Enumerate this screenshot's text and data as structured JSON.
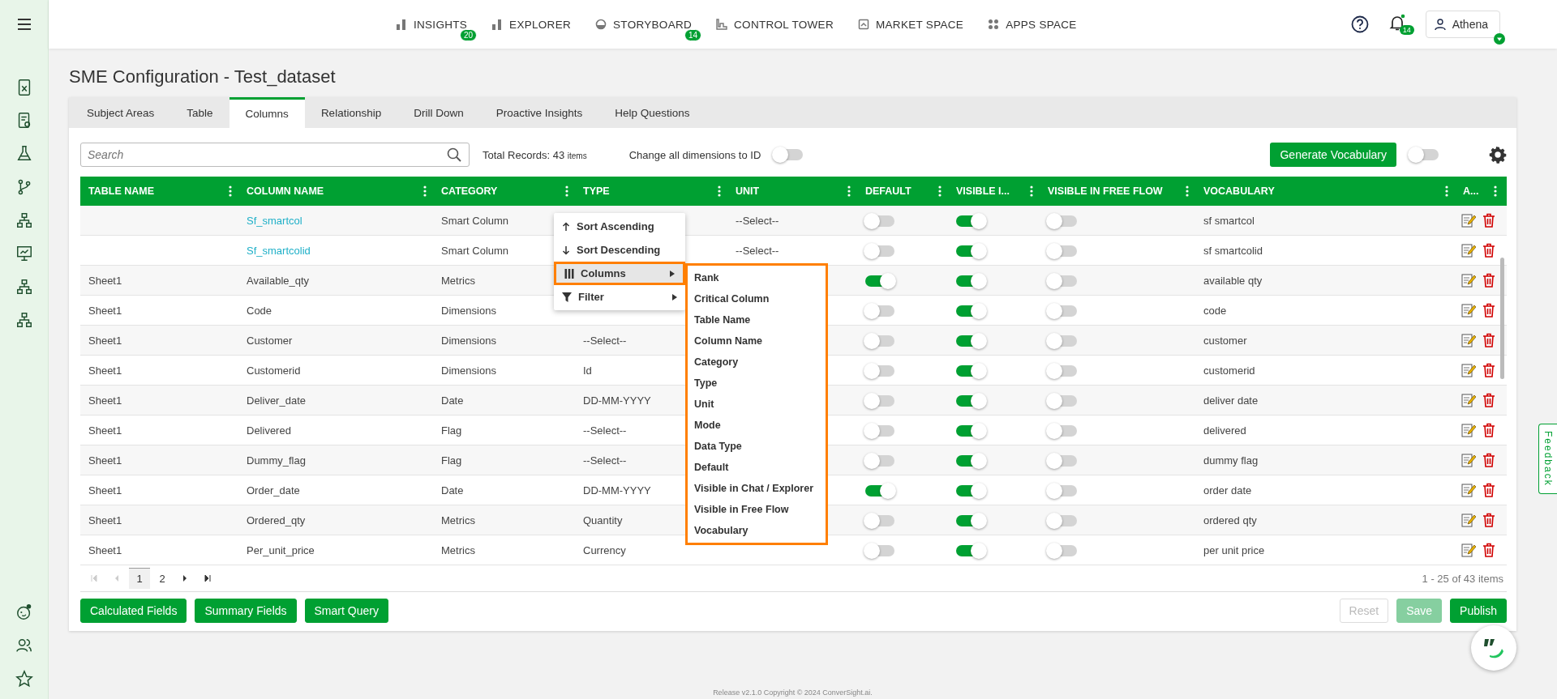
{
  "nav": [
    {
      "label": "INSIGHTS",
      "badge": "20"
    },
    {
      "label": "EXPLORER"
    },
    {
      "label": "STORYBOARD",
      "badge": "14"
    },
    {
      "label": "CONTROL TOWER"
    },
    {
      "label": "MARKET SPACE"
    },
    {
      "label": "APPS SPACE"
    }
  ],
  "notifications": {
    "badge": "14"
  },
  "user": {
    "name": "Athena"
  },
  "page_title": "SME Configuration - Test_dataset",
  "tabs": [
    {
      "label": "Subject Areas",
      "selected": false
    },
    {
      "label": "Table",
      "selected": false
    },
    {
      "label": "Columns",
      "selected": true
    },
    {
      "label": "Relationship",
      "selected": false
    },
    {
      "label": "Drill Down",
      "selected": false
    },
    {
      "label": "Proactive Insights",
      "selected": false
    },
    {
      "label": "Help Questions",
      "selected": false
    }
  ],
  "search": {
    "placeholder": "Search"
  },
  "total_records": {
    "label": "Total Records: 43",
    "unit": "items"
  },
  "dimension_toggle": {
    "label": "Change all dimensions to ID",
    "on": false
  },
  "generate_button": "Generate Vocabulary",
  "vocab_toggle": {
    "on": false
  },
  "columns": [
    "TABLE NAME",
    "COLUMN NAME",
    "CATEGORY",
    "TYPE",
    "UNIT",
    "DEFAULT",
    "VISIBLE I...",
    "VISIBLE IN FREE FLOW",
    "VOCABULARY",
    "A..."
  ],
  "rows": [
    {
      "column": "Sf_smartcol",
      "link": true,
      "category": "Smart Column",
      "unit": "--Select--",
      "default": false,
      "visible": true,
      "free_flow": false,
      "vocabulary": "sf smartcol"
    },
    {
      "column": "Sf_smartcolid",
      "link": true,
      "category": "Smart Column",
      "unit": "--Select--",
      "default": false,
      "visible": true,
      "free_flow": false,
      "vocabulary": "sf smartcolid"
    },
    {
      "table": "Sheet1",
      "column": "Available_qty",
      "link": false,
      "category": "Metrics",
      "default": true,
      "visible": true,
      "free_flow": false,
      "vocabulary": "available qty"
    },
    {
      "table": "Sheet1",
      "column": "Code",
      "link": false,
      "category": "Dimensions",
      "default": false,
      "visible": true,
      "free_flow": false,
      "vocabulary": "code"
    },
    {
      "table": "Sheet1",
      "column": "Customer",
      "link": false,
      "category": "Dimensions",
      "type": "--Select--",
      "default": false,
      "visible": true,
      "free_flow": false,
      "vocabulary": "customer"
    },
    {
      "table": "Sheet1",
      "column": "Customerid",
      "link": false,
      "category": "Dimensions",
      "type": "Id",
      "default": false,
      "visible": true,
      "free_flow": false,
      "vocabulary": "customerid"
    },
    {
      "table": "Sheet1",
      "column": "Deliver_date",
      "link": false,
      "category": "Date",
      "type": "DD-MM-YYYY",
      "default": false,
      "visible": true,
      "free_flow": false,
      "vocabulary": "deliver date"
    },
    {
      "table": "Sheet1",
      "column": "Delivered",
      "link": false,
      "category": "Flag",
      "type": "--Select--",
      "default": false,
      "visible": true,
      "free_flow": false,
      "vocabulary": "delivered"
    },
    {
      "table": "Sheet1",
      "column": "Dummy_flag",
      "link": false,
      "category": "Flag",
      "type": "--Select--",
      "default": false,
      "visible": true,
      "free_flow": false,
      "vocabulary": "dummy flag"
    },
    {
      "table": "Sheet1",
      "column": "Order_date",
      "link": false,
      "category": "Date",
      "type": "DD-MM-YYYY",
      "default": true,
      "visible": true,
      "free_flow": false,
      "vocabulary": "order date"
    },
    {
      "table": "Sheet1",
      "column": "Ordered_qty",
      "link": false,
      "category": "Metrics",
      "type": "Quantity",
      "default": false,
      "visible": true,
      "free_flow": false,
      "vocabulary": "ordered qty"
    },
    {
      "table": "Sheet1",
      "column": "Per_unit_price",
      "link": false,
      "category": "Metrics",
      "type": "Currency",
      "default": false,
      "visible": true,
      "free_flow": false,
      "vocabulary": "per unit price"
    }
  ],
  "pagination": {
    "pages": [
      {
        "label": "1",
        "selected": true
      },
      {
        "label": "2",
        "selected": false
      }
    ],
    "info": "1 - 25 of 43 items"
  },
  "left_buttons": [
    "Calculated Fields",
    "Summary Fields",
    "Smart Query"
  ],
  "right_buttons": [
    {
      "label": "Reset",
      "kind": "outline",
      "disabled": true
    },
    {
      "label": "Save",
      "kind": "solid",
      "disabled": true
    },
    {
      "label": "Publish",
      "kind": "solid",
      "disabled": false
    }
  ],
  "context_menu": [
    {
      "label": "Sort Ascending",
      "selected": false
    },
    {
      "label": "Sort Descending",
      "selected": false
    },
    {
      "label": "Columns",
      "submenu": true,
      "selected": true
    },
    {
      "label": "Filter",
      "submenu": true,
      "selected": false
    }
  ],
  "columns_submenu": [
    "Rank",
    "Critical Column",
    "Table Name",
    "Column Name",
    "Category",
    "Type",
    "Unit",
    "Mode",
    "Data Type",
    "Default",
    "Visible in Chat / Explorer",
    "Visible in Free Flow",
    "Vocabulary"
  ],
  "feedback": "Feedback",
  "footer": "Release v2.1.0 Copyright © 2024 ConverSight.ai."
}
